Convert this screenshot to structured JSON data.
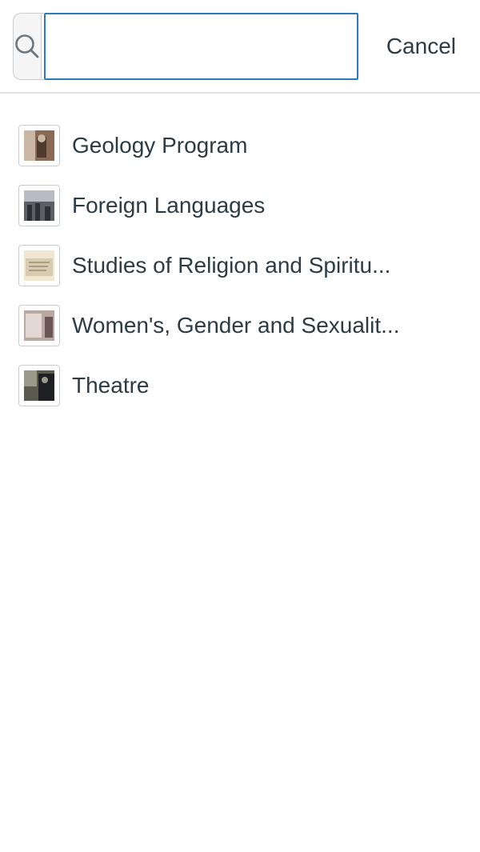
{
  "search": {
    "value": "",
    "placeholder": "",
    "cancel_label": "Cancel",
    "icon": "search-icon"
  },
  "results": [
    {
      "label": "Geology Program",
      "thumbnail": "course-thumbnail",
      "colors": [
        "#8a6a55",
        "#c9b7a4",
        "#4e3a2f"
      ]
    },
    {
      "label": "Foreign Languages",
      "thumbnail": "course-thumbnail",
      "colors": [
        "#5d5f66",
        "#b8bcc2",
        "#2f3036"
      ]
    },
    {
      "label": "Studies of Religion and Spiritu...",
      "thumbnail": "course-thumbnail",
      "colors": [
        "#d8ccb0",
        "#efe7d2",
        "#9c8f74"
      ]
    },
    {
      "label": "Women's, Gender and Sexualit...",
      "thumbnail": "course-thumbnail",
      "colors": [
        "#b9a8a2",
        "#e3d8d3",
        "#6a5655"
      ]
    },
    {
      "label": "Theatre",
      "thumbnail": "course-thumbnail",
      "colors": [
        "#5b5a4e",
        "#9b9a8a",
        "#1f2024"
      ]
    }
  ],
  "colors": {
    "focus_border": "#2b7abc",
    "text": "#2d3b45",
    "border": "#c7cdd1",
    "addon_bg": "#f5f5f5"
  }
}
